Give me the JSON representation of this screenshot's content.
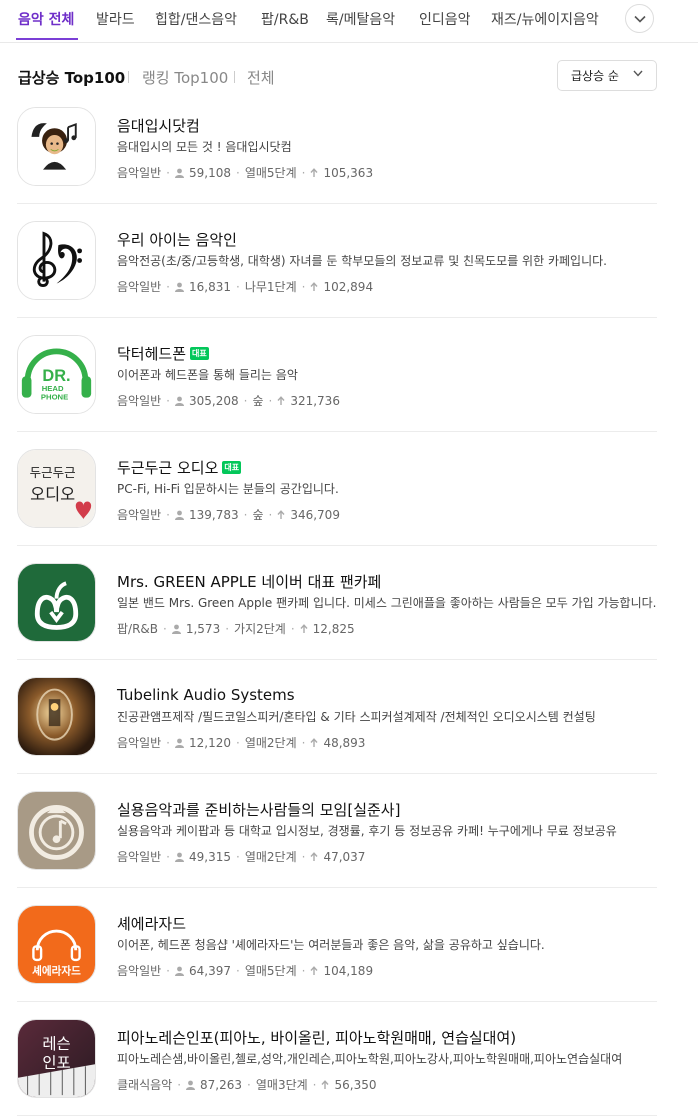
{
  "tabs": {
    "items": [
      "음악 전체",
      "발라드",
      "힙합/댄스음악",
      "팝/R&B",
      "록/메탈음악",
      "인디음악",
      "재즈/뉴에이지음악"
    ],
    "active_index": 0
  },
  "filters": {
    "items": [
      "급상승 Top100",
      "랭킹 Top100",
      "전체"
    ],
    "active_index": 0,
    "sort_label": "급상승 순"
  },
  "cafes": [
    {
      "name": "음대입시닷컴",
      "badge": "",
      "desc": "음대입시의 모든 것 ! 음대입시닷컴",
      "category": "음악일반",
      "members": "59,108",
      "level": "열매5단계",
      "score": "105,363",
      "thumb_icon": "musician-caricature-icon"
    },
    {
      "name": "우리 아이는 음악인",
      "badge": "",
      "desc": "음악전공(초/중/고등학생, 대학생) 자녀를 둔 학부모들의 정보교류 및 친목도모를 위한 카페입니다.",
      "category": "음악일반",
      "members": "16,831",
      "level": "나무1단계",
      "score": "102,894",
      "thumb_icon": "treble-bass-clef-icon"
    },
    {
      "name": "닥터헤드폰",
      "badge": "대표",
      "desc": "이어폰과 헤드폰을 통해 들리는 음악",
      "category": "음악일반",
      "members": "305,208",
      "level": "숲",
      "score": "321,736",
      "thumb_icon": "headphone-logo-icon",
      "thumb_text": [
        "DR.",
        "HEAD",
        "PHONE"
      ]
    },
    {
      "name": "두근두근 오디오",
      "badge": "대표",
      "desc": "PC-Fi, Hi-Fi 입문하시는 분들의 공간입니다.",
      "category": "음악일반",
      "members": "139,783",
      "level": "숲",
      "score": "346,709",
      "thumb_icon": "handwritten-logo-icon",
      "thumb_text": [
        "두근두근",
        "오디오"
      ]
    },
    {
      "name": "Mrs. GREEN APPLE 네이버 대표 팬카페",
      "badge": "",
      "desc": "일본 밴드 Mrs. Green Apple 팬카페 입니다. 미세스 그린애플을 좋아하는 사람들은 모두 가입 가능합니다.",
      "category": "팝/R&B",
      "members": "1,573",
      "level": "가지2단계",
      "score": "12,825",
      "thumb_icon": "green-apple-logo-icon"
    },
    {
      "name": "Tubelink Audio Systems",
      "badge": "",
      "desc": "진공관앰프제작 /필드코일스피커/혼타입 & 기타 스피커설계제작 /전체적인 오디오시스템 컨설팅",
      "category": "음악일반",
      "members": "12,120",
      "level": "열매2단계",
      "score": "48,893",
      "thumb_icon": "vacuum-tube-photo-icon"
    },
    {
      "name": "실용음악과를 준비하는사람들의 모임[실준사]",
      "badge": "",
      "desc": "실용음악과 케이팝과 등 대학교 입시정보, 경쟁률, 후기 등 정보공유 카페! 누구에게나 무료 정보공유",
      "category": "음악일반",
      "members": "49,315",
      "level": "열매2단계",
      "score": "47,037",
      "thumb_icon": "music-note-badge-icon"
    },
    {
      "name": "셰에라자드",
      "badge": "",
      "desc": "이어폰, 헤드폰 청음샵 '셰에라자드'는 여러분들과 좋은 음악, 삶을 공유하고 싶습니다.",
      "category": "음악일반",
      "members": "64,397",
      "level": "열매5단계",
      "score": "104,189",
      "thumb_icon": "orange-headphone-logo-icon",
      "thumb_text": [
        "셰에라자드"
      ]
    },
    {
      "name": "피아노레슨인포(피아노, 바이올린, 피아노학원매매, 연습실대여)",
      "badge": "",
      "desc": "피아노레슨샘,바이올린,첼로,성악,개인레슨,피아노학원,피아노강사,피아노학원매매,피아노연습실대여",
      "category": "클래식음악",
      "members": "87,263",
      "level": "열매3단계",
      "score": "56,350",
      "thumb_icon": "piano-photo-icon",
      "thumb_text": [
        "레슨",
        "인포"
      ]
    }
  ]
}
